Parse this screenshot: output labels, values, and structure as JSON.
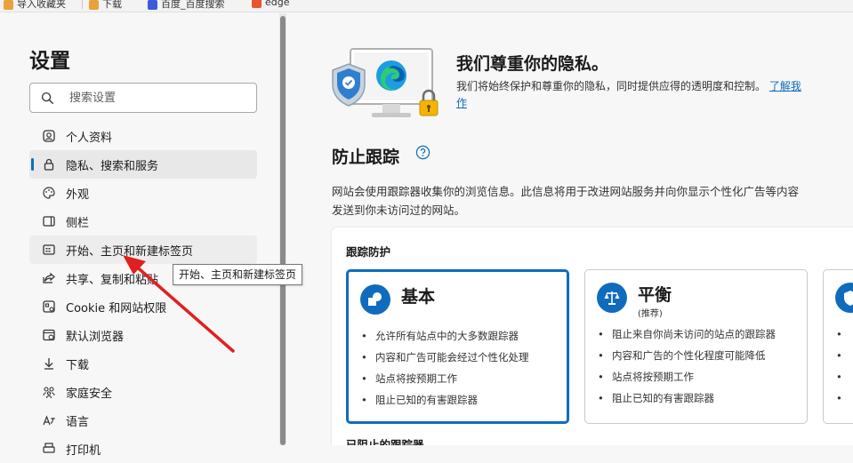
{
  "bookmarks": [
    {
      "label": "导入收藏夹",
      "color": "#e9a23b"
    },
    {
      "label": "下载",
      "color": "#e9a23b"
    },
    {
      "label": "百度_百度搜索",
      "color": "#3b5bdb"
    },
    {
      "label": "edge",
      "color": "#e8542f"
    }
  ],
  "sidebar": {
    "title": "设置",
    "search_placeholder": "搜索设置",
    "items": [
      {
        "label": "个人资料",
        "icon": "profile-icon"
      },
      {
        "label": "隐私、搜索和服务",
        "icon": "lock-icon"
      },
      {
        "label": "外观",
        "icon": "palette-icon"
      },
      {
        "label": "侧栏",
        "icon": "sidebar-icon"
      },
      {
        "label": "开始、主页和新建标签页",
        "icon": "home-tabs-icon"
      },
      {
        "label": "共享、复制和粘贴",
        "icon": "share-icon"
      },
      {
        "label": "Cookie 和网站权限",
        "icon": "cookie-icon"
      },
      {
        "label": "默认浏览器",
        "icon": "browser-icon"
      },
      {
        "label": "下载",
        "icon": "download-icon"
      },
      {
        "label": "家庭安全",
        "icon": "family-icon"
      },
      {
        "label": "语言",
        "icon": "language-icon"
      },
      {
        "label": "打印机",
        "icon": "printer-icon"
      }
    ],
    "active_index": 1,
    "hover_index": 4
  },
  "tooltip": "开始、主页和新建标签页",
  "privacy": {
    "title": "我们尊重你的隐私。",
    "desc": "我们将始终保护和尊重你的隐私，同时提供应得的透明度和控制。",
    "link": "了解我",
    "link_cont": "作"
  },
  "tracking": {
    "title": "防止跟踪",
    "desc_line1": "网站会使用跟踪器收集你的浏览信息。此信息将用于改进网站服务并向你显示个性化广告等内容",
    "desc_line2": "发送到你未访问过的网站。",
    "card_label": "跟踪防护",
    "blocked_label": "已阻止的跟踪器",
    "options": [
      {
        "name": "基本",
        "sub": "",
        "bullets": [
          "允许所有站点中的大多数跟踪器",
          "内容和广告可能会经过个性化处理",
          "站点将按预期工作",
          "阻止已知的有害跟踪器"
        ]
      },
      {
        "name": "平衡",
        "sub": "(推荐)",
        "bullets": [
          "阻止来自你尚未访问的站点的跟踪器",
          "内容和广告的个性化程度可能降低",
          "站点将按预期工作",
          "阻止已知的有害跟踪器"
        ]
      },
      {
        "name": "",
        "sub": "",
        "bullets": [
          "",
          "",
          "",
          ""
        ]
      }
    ],
    "selected_index": 0
  },
  "colors": {
    "accent": "#0f6cbd",
    "arrow": "#e02020"
  }
}
